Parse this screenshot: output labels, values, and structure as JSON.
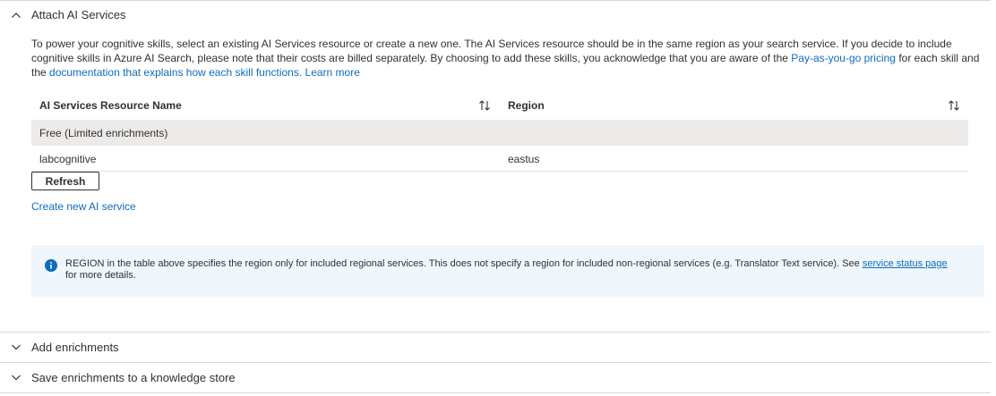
{
  "sections": {
    "attach": {
      "title": "Attach AI Services"
    },
    "enrich": {
      "title": "Add enrichments"
    },
    "store": {
      "title": "Save enrichments to a knowledge store"
    }
  },
  "description": {
    "text1": "To power your cognitive skills, select an existing AI Services resource or create a new one. The AI Services resource should be in the same region as your search service. If you decide to include cognitive skills in Azure AI Search, please note that their costs are billed separately. By choosing to add these skills, you acknowledge that you are aware of the ",
    "link1": "Pay-as-you-go pricing",
    "text2": " for each skill and the ",
    "link2": "documentation that explains how each skill functions.",
    "text3": " ",
    "link3": "Learn more"
  },
  "table": {
    "columns": [
      "AI Services Resource Name",
      "Region"
    ],
    "rows": [
      {
        "name": "Free (Limited enrichments)",
        "region": ""
      },
      {
        "name": "labcognitive",
        "region": "eastus"
      }
    ]
  },
  "buttons": {
    "refresh": "Refresh"
  },
  "links": {
    "create_service": "Create new AI service"
  },
  "info": {
    "text1": "REGION in the table above specifies the region only for included regional services. This does not specify a region for included non-regional services (e.g. Translator Text service). See ",
    "link": "service status page",
    "text2": " for more details."
  },
  "colors": {
    "link": "#0f6cbd",
    "selected_row": "#edebe9",
    "info_bg": "#eff6fc",
    "info_icon": "#0f6cbd"
  },
  "icons": {
    "collapse": "chevron-up-icon",
    "expand": "chevron-down-icon",
    "sort": "sort-arrows-icon",
    "info": "info-icon"
  }
}
